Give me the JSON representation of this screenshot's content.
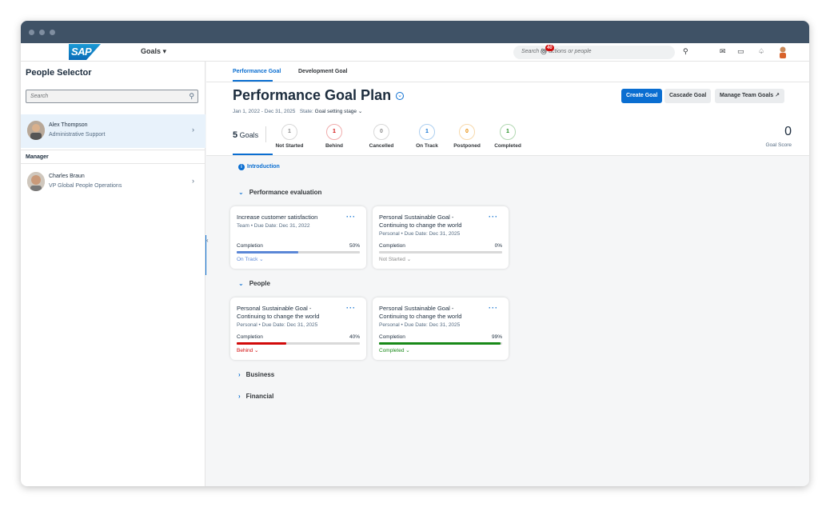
{
  "shell": {
    "logo_text": "SAP",
    "goals_menu": "Goals ▾",
    "search_placeholder": "Search for actions or people",
    "notification_badge": "40"
  },
  "left": {
    "title": "People Selector",
    "search_placeholder": "Search",
    "selected_person": {
      "name": "Alex Thompson",
      "role": "Administrative Support"
    },
    "manager_heading": "Manager",
    "manager": {
      "name": "Charles Braun",
      "role": "VP Global People Operations"
    }
  },
  "tabs": [
    "Performance Goal",
    "Development Goal"
  ],
  "header": {
    "title": "Performance Goal Plan",
    "date_range": "Jan 1, 2022 - Dec 31, 2025",
    "state_label": "State:",
    "state_value": "Goal setting stage",
    "create_goal": "Create Goal",
    "cascade_goal": "Cascade Goal",
    "manage_team_goals": "Manage Team Goals",
    "goals_number": "5",
    "goals_label": "Goals",
    "score_value": "0",
    "score_label": "Goal Score"
  },
  "stats": [
    {
      "count": "1",
      "label": "Not Started",
      "color": "#8a8a8a"
    },
    {
      "count": "1",
      "label": "Behind",
      "color": "#d20a0a"
    },
    {
      "count": "0",
      "label": "Cancelled",
      "color": "#8a8a8a"
    },
    {
      "count": "1",
      "label": "On Track",
      "color": "#0a6ed1"
    },
    {
      "count": "0",
      "label": "Postponed",
      "color": "#e78c07"
    },
    {
      "count": "1",
      "label": "Completed",
      "color": "#188918"
    }
  ],
  "content": {
    "intro": "Introduction",
    "sections": [
      "Performance evaluation",
      "People",
      "Business",
      "Financial"
    ],
    "completion_label": "Completion",
    "cards": [
      {
        "title": "Increase customer satisfaction",
        "meta": "Team • Due Date: Dec 31, 2022",
        "pct": "50%",
        "progress": 50,
        "status": "On Track",
        "color": "#5b87d6"
      },
      {
        "title": "Personal Sustainable Goal - Continuing to change the world",
        "meta": "Personal • Due Date: Dec 31, 2025",
        "pct": "0%",
        "progress": 0,
        "status": "Not Started",
        "color": "#8a8a8a"
      },
      {
        "title": "Personal Sustainable Goal - Continuing to change the world",
        "meta": "Personal • Due Date: Dec 31, 2025",
        "pct": "40%",
        "progress": 40,
        "status": "Behind",
        "color": "#d20a0a"
      },
      {
        "title": "Personal Sustainable Goal - Continuing to change the world",
        "meta": "Personal • Due Date: Dec 31, 2025",
        "pct": "99%",
        "progress": 99,
        "status": "Completed",
        "color": "#188918"
      }
    ]
  }
}
